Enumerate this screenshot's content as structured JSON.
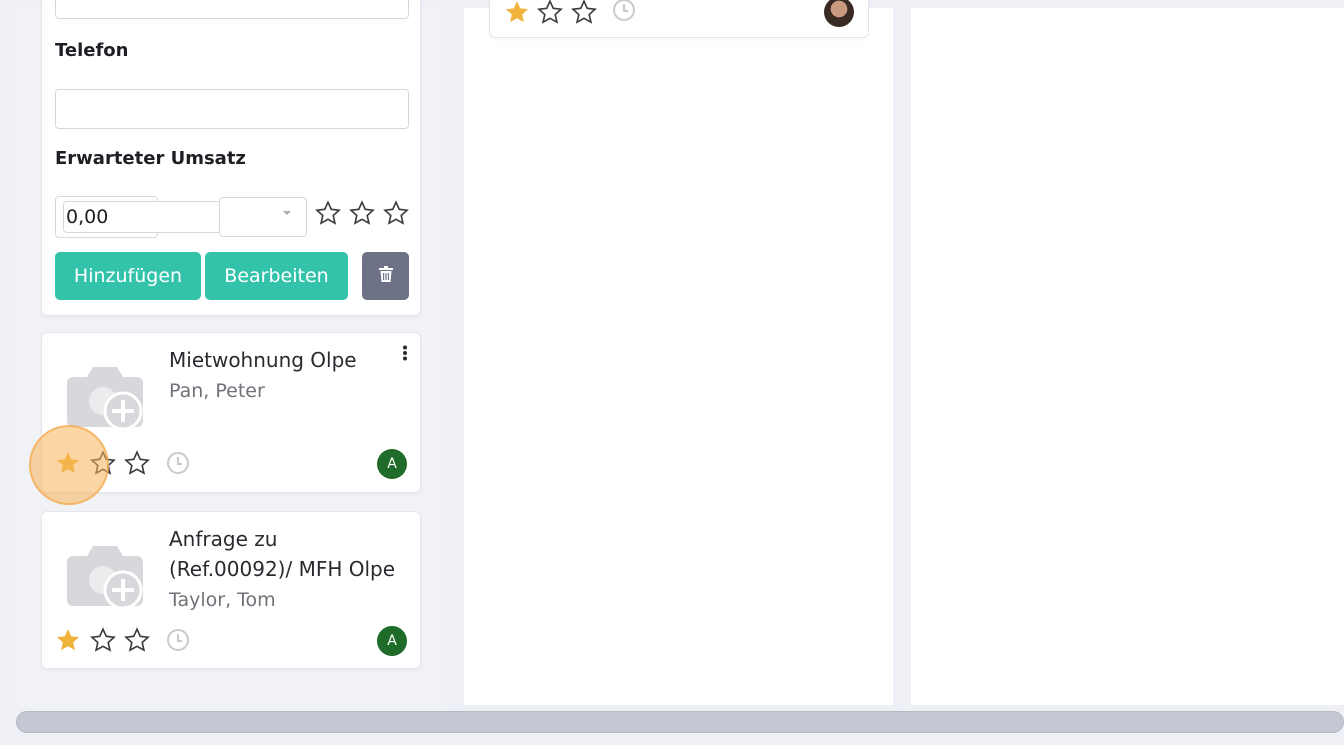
{
  "form": {
    "phone_label": "Telefon",
    "phone_value": "",
    "revenue_label": "Erwarteter Umsatz",
    "revenue_value": "0,00",
    "currency_value": "",
    "add_label": "Hinzufügen",
    "edit_label": "Bearbeiten",
    "rating": 0
  },
  "leads": [
    {
      "title": "Mietwohnung Olpe",
      "contact": "Pan, Peter",
      "rating": 1,
      "avatar": "A"
    },
    {
      "title_line1": "Anfrage zu",
      "title_line2": "(Ref.00092)/ MFH Olpe",
      "contact": "Taylor, Tom",
      "rating": 1,
      "avatar": "A"
    }
  ],
  "top_card": {
    "rating": 1
  },
  "colors": {
    "teal": "#33c3aa",
    "grey_button": "#6d7287",
    "star": "#f0b43c",
    "avatar": "#1f6b2a",
    "highlight": "#f7b45a"
  },
  "icons": [
    "star-filled-icon",
    "star-outline-icon",
    "trash-icon",
    "camera-plus-icon",
    "clock-icon",
    "more-vertical-icon"
  ]
}
